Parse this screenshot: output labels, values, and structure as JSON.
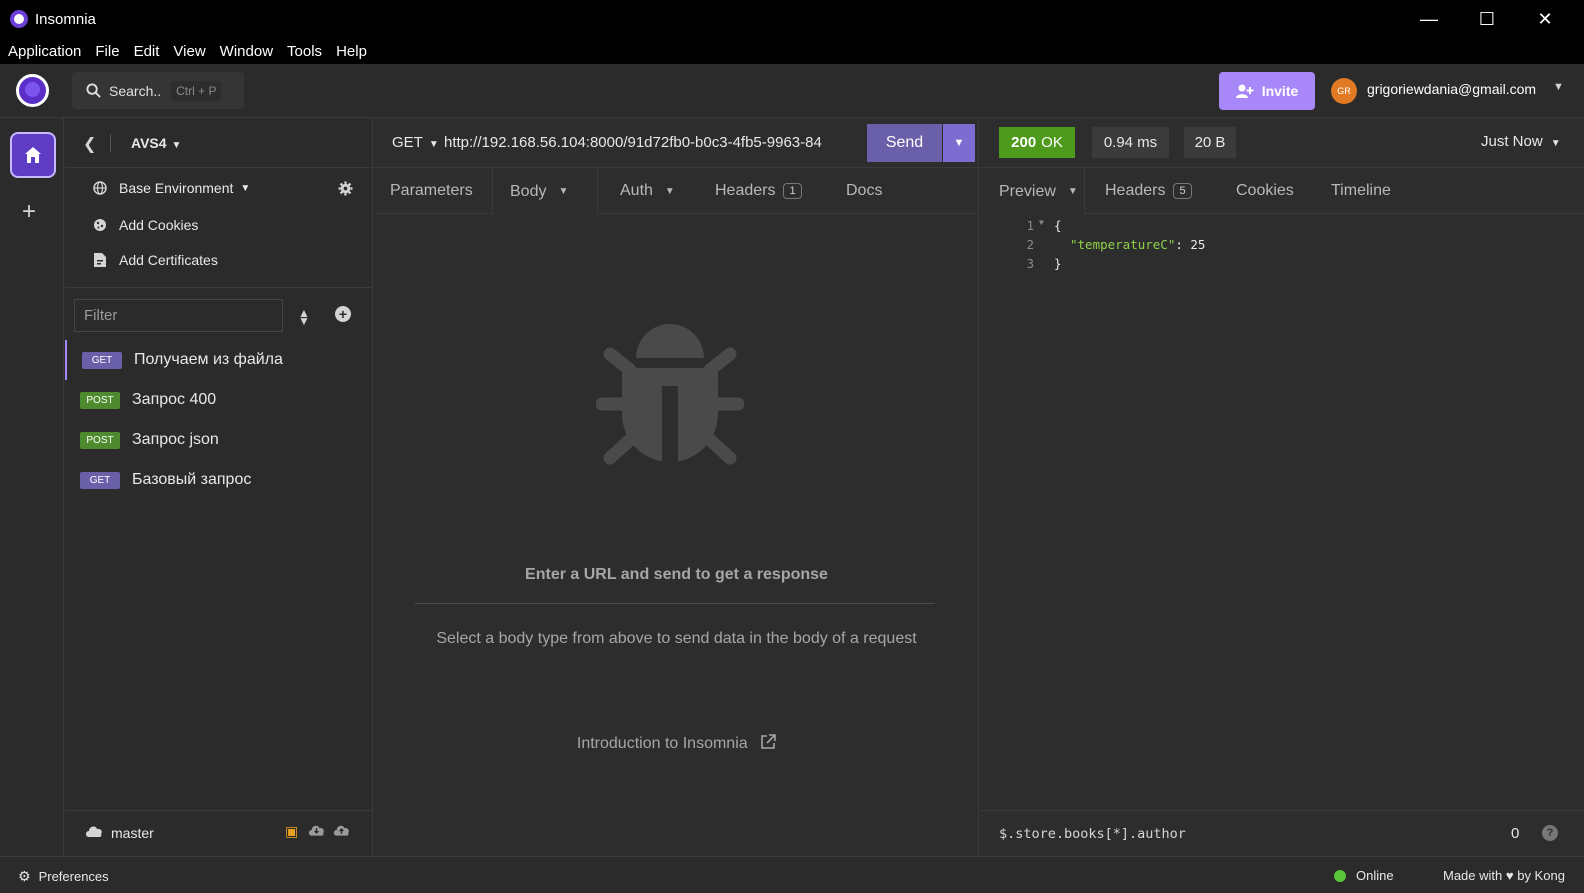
{
  "window": {
    "title": "Insomnia"
  },
  "menu": [
    "Application",
    "File",
    "Edit",
    "View",
    "Window",
    "Tools",
    "Help"
  ],
  "header": {
    "search_label": "Search..",
    "search_shortcut": "Ctrl + P",
    "invite_label": "Invite",
    "avatar_initials": "GR",
    "user_email": "grigoriewdania@gmail.com"
  },
  "sidebar": {
    "project": "AVS4",
    "environment": "Base Environment",
    "add_cookies": "Add Cookies",
    "add_certificates": "Add Certificates",
    "filter_placeholder": "Filter",
    "requests": [
      {
        "method": "GET",
        "name": "Получаем из файла",
        "active": true
      },
      {
        "method": "POST",
        "name": "Запрос 400",
        "active": false
      },
      {
        "method": "POST",
        "name": "Запрос json",
        "active": false
      },
      {
        "method": "GET",
        "name": "Базовый запрос",
        "active": false
      }
    ],
    "branch": "master"
  },
  "request": {
    "method": "GET",
    "url": "http://192.168.56.104:8000/91d72fb0-b0c3-4fb5-9963-84",
    "send_label": "Send",
    "tabs": {
      "parameters": "Parameters",
      "body": "Body",
      "auth": "Auth",
      "headers": "Headers",
      "headers_count": "1",
      "docs": "Docs"
    },
    "empty_title": "Enter a URL and send to get a response",
    "empty_desc": "Select a body type from above to send data in the body of a request",
    "intro_link": "Introduction to Insomnia"
  },
  "response": {
    "status_code": "200",
    "status_text": "OK",
    "time": "0.94 ms",
    "size": "20 B",
    "timestamp": "Just Now",
    "tabs": {
      "preview": "Preview",
      "headers": "Headers",
      "headers_count": "5",
      "cookies": "Cookies",
      "timeline": "Timeline"
    },
    "body_lines": {
      "l1": "{",
      "l2_key": "\"temperatureC\"",
      "l2_value": ": 25",
      "l3": "}"
    },
    "line_numbers": [
      "1",
      "2",
      "3"
    ],
    "filter_query": "$.store.books[*].author",
    "filter_count": "0"
  },
  "statusbar": {
    "preferences": "Preferences",
    "online": "Online",
    "made_with_prefix": "Made with",
    "made_with_suffix": "by Kong"
  },
  "colors": {
    "accent": "#a888f8",
    "send": "#6a5fa9",
    "status_ok": "#4e9a1c",
    "get_badge": "#6a5fa9",
    "post_badge": "#4e8a2e"
  }
}
